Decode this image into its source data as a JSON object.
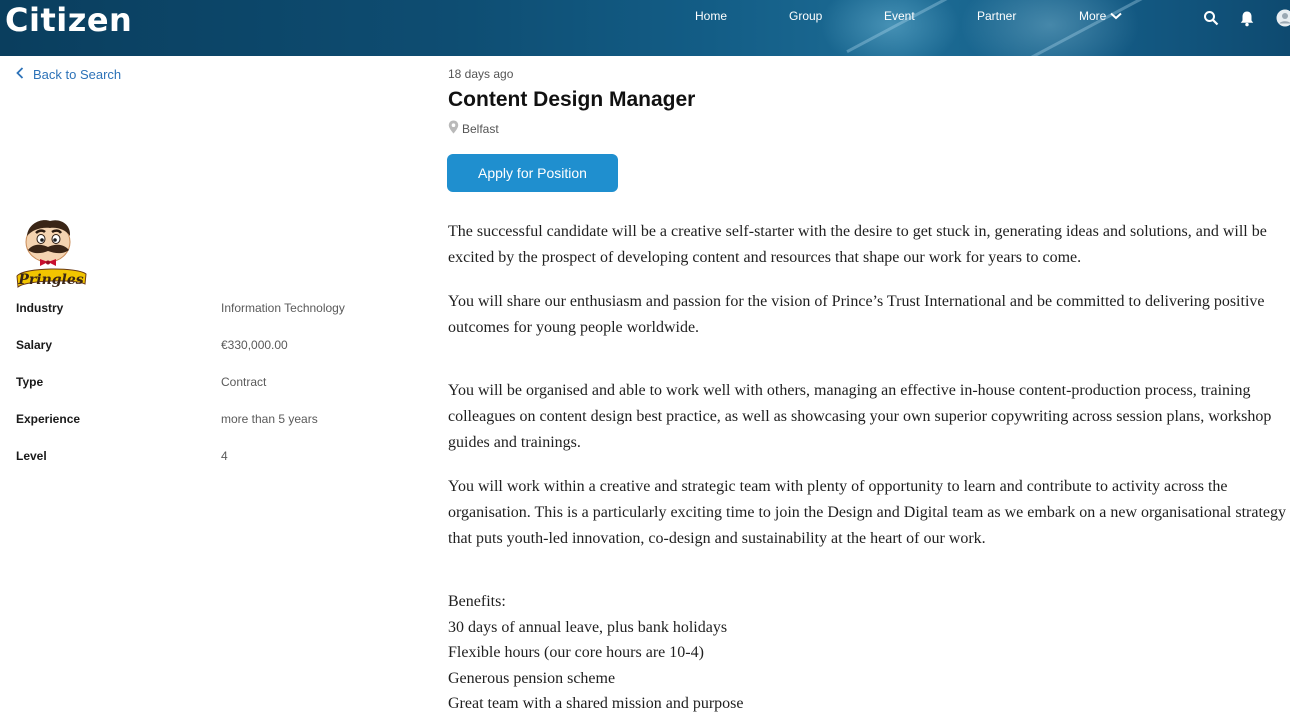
{
  "header": {
    "logo": "Citizen",
    "nav": [
      "Home",
      "Group",
      "Event",
      "Partner",
      "More"
    ],
    "icons": [
      "search-icon",
      "bell-icon",
      "user-avatar-icon"
    ]
  },
  "sidebar": {
    "back_label": "Back to Search",
    "company_logo_icon": "pringles-logo",
    "company_logo_text": "Pringles",
    "details": [
      {
        "label": "Industry",
        "value": "Information Technology"
      },
      {
        "label": "Salary",
        "value": "€330,000.00"
      },
      {
        "label": "Type",
        "value": "Contract"
      },
      {
        "label": "Experience",
        "value": "more than 5 years"
      },
      {
        "label": "Level",
        "value": "4"
      }
    ]
  },
  "job": {
    "posted": "18 days ago",
    "title": "Content Design Manager",
    "location": "Belfast",
    "apply_label": "Apply for Position",
    "paragraphs": [
      "The successful candidate will be a creative self-starter with the desire to get stuck in, generating ideas and solutions, and will be excited by the prospect of developing content and resources that shape our work for years to come.",
      "You will share our enthusiasm and passion for the vision of Prince’s Trust International and be committed to delivering positive outcomes for young people worldwide.",
      "You will be organised and able to work well with others, managing an effective in-house content-production process, training colleagues on content design best practice, as well as showcasing your own superior copywriting across session plans, workshop guides and trainings.",
      "You will work within a creative and strategic team with plenty of opportunity to learn and contribute to activity across the organisation. This is a particularly exciting time to join the Design and Digital team as we embark on a new organisational strategy that puts youth-led innovation, co-design and sustainability at the heart of our work."
    ],
    "benefits_heading": "Benefits:",
    "benefits": [
      "30 days of annual leave, plus bank holidays",
      "Flexible hours (our core hours are 10-4)",
      "Generous pension scheme",
      "Great team with a shared mission and purpose"
    ]
  },
  "colors": {
    "header_bg": "#0e4d72",
    "accent": "#1f8fcf",
    "link": "#2c72b8"
  }
}
